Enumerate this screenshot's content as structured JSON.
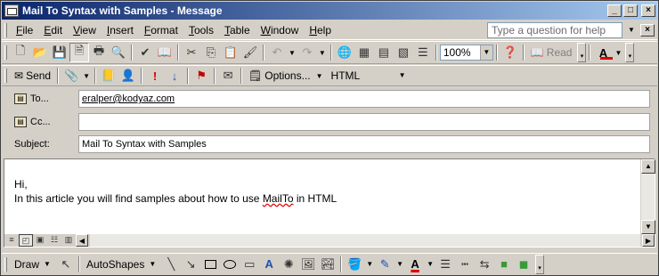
{
  "window": {
    "title": "Mail To Syntax with Samples - Message",
    "controls": [
      "minimize",
      "maximize",
      "close"
    ]
  },
  "menubar": {
    "items": [
      {
        "label": "File",
        "u": "F",
        "rest": "ile"
      },
      {
        "label": "Edit",
        "u": "E",
        "rest": "dit"
      },
      {
        "label": "View",
        "u": "V",
        "rest": "iew"
      },
      {
        "label": "Insert",
        "u": "I",
        "rest": "nsert"
      },
      {
        "label": "Format",
        "u": "F",
        "rest": "ormat"
      },
      {
        "label": "Tools",
        "u": "T",
        "rest": "ools"
      },
      {
        "label": "Table",
        "u": "T",
        "rest": "able"
      },
      {
        "label": "Window",
        "u": "W",
        "rest": "indow"
      },
      {
        "label": "Help",
        "u": "H",
        "rest": "elp"
      }
    ],
    "ask_placeholder": "Type a question for help"
  },
  "standard_toolbar": {
    "zoom": "100%",
    "read_label": "Read"
  },
  "email_toolbar": {
    "send_label": "Send",
    "options_label": "Options...",
    "format": "HTML"
  },
  "fields": {
    "to_label": "To...",
    "to_value": "eralper@kodyaz.com",
    "cc_label": "Cc...",
    "cc_value": "",
    "subject_label": "Subject:",
    "subject_value": "Mail To Syntax with Samples"
  },
  "body": {
    "line1": "Hi,",
    "line2_before": "In this article you will find samples about how to use ",
    "line2_squiggle": "MailTo",
    "line2_after": " in HTML"
  },
  "drawing_toolbar": {
    "draw_label": "Draw",
    "autoshapes_label": "AutoShapes"
  },
  "colors": {
    "title_start": "#0a246a",
    "title_end": "#a6caf0",
    "chrome": "#d4d0c8",
    "font_color_accent": "#e00000"
  }
}
